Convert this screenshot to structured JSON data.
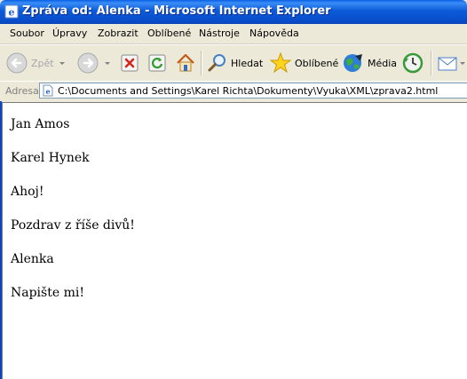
{
  "window": {
    "title": "Zpráva od: Alenka - Microsoft Internet Explorer"
  },
  "menu": {
    "items": [
      "Soubor",
      "Úpravy",
      "Zobrazit",
      "Oblíbené",
      "Nástroje",
      "Nápověda"
    ]
  },
  "toolbar": {
    "back_label": "Zpět",
    "search_label": "Hledat",
    "favorites_label": "Oblíbené",
    "media_label": "Média"
  },
  "address": {
    "label": "Adresa",
    "url": "C:\\Documents and Settings\\Karel Richta\\Dokumenty\\Vyuka\\XML\\zprava2.html"
  },
  "content": {
    "lines": [
      "Jan Amos",
      "Karel Hynek",
      "Ahoj!",
      "Pozdrav z říše divů!",
      "Alenka",
      "Napište mi!"
    ]
  },
  "colors": {
    "titlebar": "#0a5fe5",
    "chrome": "#ece9d8",
    "content_bg": "#ffffff"
  }
}
